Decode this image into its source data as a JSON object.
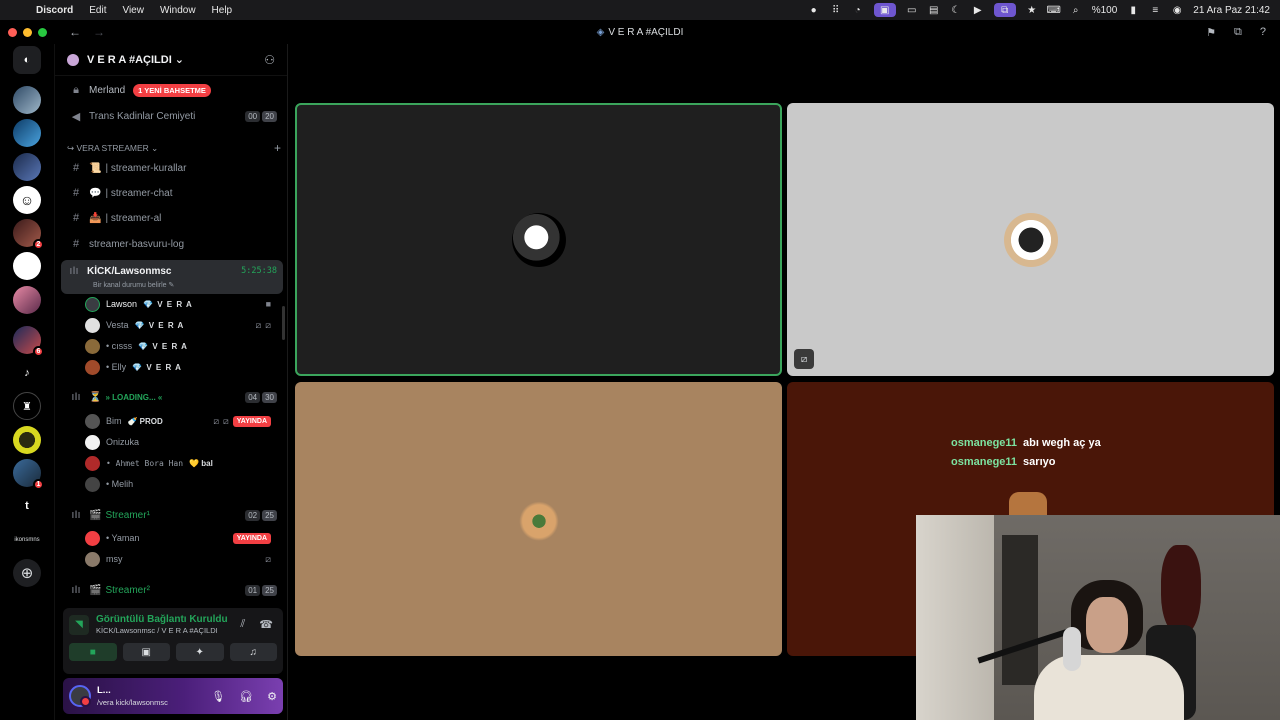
{
  "menubar": {
    "app": "Discord",
    "menus": [
      "Edit",
      "View",
      "Window",
      "Help"
    ],
    "battery": "%100",
    "datetime": "21 Ara Paz  21:42"
  },
  "window": {
    "title": "V E R A #AÇILDI"
  },
  "rail": {
    "badges": {
      "s5": "2",
      "s9": "6",
      "s13": "1"
    },
    "text_icons": {
      "t": "t",
      "small": "ikonsmns"
    }
  },
  "guild": {
    "name": "V E R A #AÇILDI ⌄"
  },
  "channels": {
    "merland": "Merland",
    "merland_pill": "1 YENİ BAHSETME",
    "trans": "Trans Kadinlar Cemiyeti",
    "trans_counts": [
      "00",
      "20"
    ],
    "category": "↪ VERA STREAMER ⌄",
    "kurallar": "| streamer-kurallar",
    "chat": "| streamer-chat",
    "al": "| streamer-al",
    "basvuru": "streamer-basvuru-log",
    "kick_voice": "KİCK/Lawsonmsc",
    "kick_time": "5:25:38",
    "kick_status": "Bir kanal durumu belirle ✎",
    "loading": "» LOADING... «",
    "loading_counts": [
      "04",
      "30"
    ],
    "streamer1": "Streamer¹",
    "streamer1_counts": [
      "02",
      "25"
    ],
    "streamer2": "Streamer²",
    "streamer2_counts": [
      "01",
      "25"
    ]
  },
  "members": {
    "m1": {
      "name": "Lawson",
      "tag": "💎 V E R A"
    },
    "m2": {
      "name": "Vesta",
      "tag": "💎 V E R A"
    },
    "m3": {
      "name": "• cısss",
      "tag": "💎 V E R A"
    },
    "m4": {
      "name": "• Elly",
      "tag": "💎 V E R A"
    },
    "l1": {
      "name": "Bim",
      "tag": "🍼 PROD",
      "live": "YAYINDA"
    },
    "l2": {
      "name": "Onizuka"
    },
    "l3": {
      "name": "• Ahmet Bora Han",
      "tag": "💛 bal"
    },
    "l4": {
      "name": "• Melih"
    },
    "s1": {
      "name": "• Yaman",
      "live": "YAYINDA"
    },
    "s2": {
      "name": "msy"
    }
  },
  "rtc": {
    "status": "Görüntülü Bağlantı Kuruldu",
    "channel": "KİCK/Lawsonmsc / V E R A #AÇILDI"
  },
  "user": {
    "name": "L...",
    "status": "/vera kick/lawsonmsc"
  },
  "stage": {
    "chat": [
      {
        "user": "osmanege11",
        "text": "abı wegh aç ya"
      },
      {
        "user": "osmanege11",
        "text": "sarıyo"
      }
    ]
  },
  "colors": {
    "accent_green": "#23a55a",
    "mention_red": "#f23f43",
    "blurple": "#5865f2"
  }
}
